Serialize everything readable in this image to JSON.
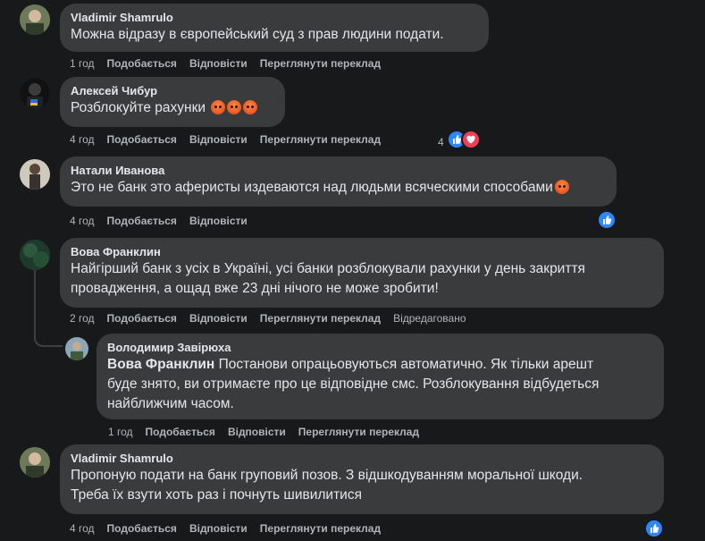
{
  "labels": {
    "like": "Подобається",
    "reply": "Відповісти",
    "translate": "Переглянути переклад"
  },
  "comments": [
    {
      "author": "Vladimir Shamrulo",
      "text": "Можна відразу в європейський суд з прав людини подати.",
      "time": "1 год"
    },
    {
      "author": "Алексей Чибур",
      "text": "Розблокуйте рахунки",
      "time": "4 год",
      "reaction_count": "4"
    },
    {
      "author": "Натали Иванова",
      "text": "Это не банк это аферисты издеваются над людьми всяческими способами",
      "time": "4 год"
    },
    {
      "author": "Вова Франклин",
      "text_line1": "Найгірший банк з усіх в Україні, усі банки розблокували рахунки у день закриття",
      "text_line2": "провадження, а ощад вже 23 дні нічого не може зробити!",
      "time": "2 год",
      "edited": "Відредаговано"
    },
    {
      "author": "Володимир Завірюха",
      "mention": "Вова Франклин",
      "text_line1": "Постанови опрацьовуються автоматично. Як тільки арешт",
      "text_line2": "буде знято, ви отримаєте про це відповідне смс. Розблокування відбудеться",
      "text_line3": "найближчим часом.",
      "time": "1 год"
    },
    {
      "author": "Vladimir Shamrulo",
      "text_line1": "Пропоную подати на банк груповий позов. З відшкодуванням моральної шкоди.",
      "text_line2": "Треба їх взути хоть раз і почнуть шивилитися",
      "time": "4 год"
    }
  ]
}
